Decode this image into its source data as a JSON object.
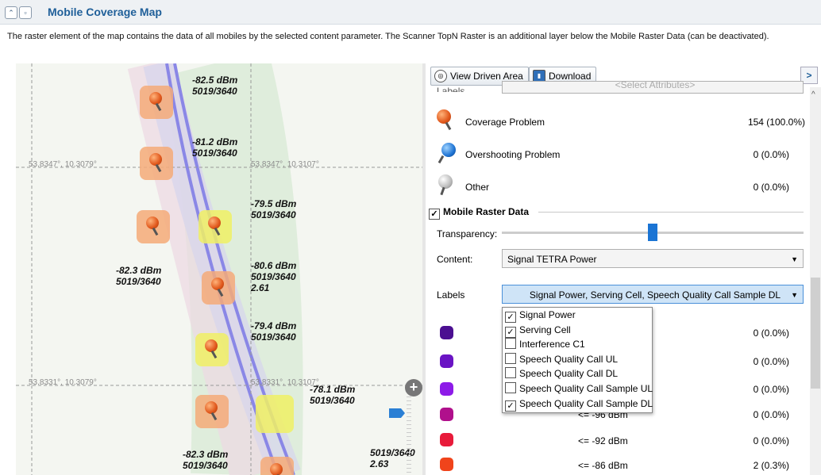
{
  "header": {
    "title": "Mobile Coverage Map",
    "collapse_icon": "double-chevron-up-icon",
    "window_icon": "window-icon"
  },
  "description": "The raster element of the map contains the data of all mobiles by the selected content parameter. The Scanner TopN Raster is an additional layer below the Mobile Raster Data (can be deactivated).",
  "map": {
    "coords": [
      "53.8347°, 10.3079°",
      "53.8347°, 10.3107°",
      "53.8331°, 10.3079°",
      "53.8331°, 10.3107°"
    ],
    "labels": [
      {
        "l1": "-82.5 dBm",
        "l2": "5019/3640",
        "l3": ""
      },
      {
        "l1": "-81.2 dBm",
        "l2": "5019/3640",
        "l3": ""
      },
      {
        "l1": "-79.5 dBm",
        "l2": "5019/3640",
        "l3": ""
      },
      {
        "l1": "-82.3 dBm",
        "l2": "5019/3640",
        "l3": ""
      },
      {
        "l1": "-80.6 dBm",
        "l2": "5019/3640",
        "l3": "2.61"
      },
      {
        "l1": "-79.4 dBm",
        "l2": "5019/3640",
        "l3": ""
      },
      {
        "l1": "-78.1 dBm",
        "l2": "5019/3640",
        "l3": ""
      },
      {
        "l1": "-82.3 dBm",
        "l2": "5019/3640",
        "l3": ""
      },
      {
        "l1": "5019/3640",
        "l2": "2.63",
        "l3": ""
      }
    ],
    "zoom_in_icon": "plus-icon"
  },
  "toolbar": {
    "view_driven_area": "View Driven Area",
    "download": "Download",
    "expand_icon": "chevron-right-icon"
  },
  "labels_row": {
    "label": "Labels",
    "placeholder": "<Select Attributes>"
  },
  "problems": [
    {
      "name": "Coverage Problem",
      "value": "154 (100.0%)",
      "icon": "orange-pin-icon"
    },
    {
      "name": "Overshooting Problem",
      "value": "0 (0.0%)",
      "icon": "blue-pin-icon"
    },
    {
      "name": "Other",
      "value": "0 (0.0%)",
      "icon": "grey-pin-icon"
    }
  ],
  "raster": {
    "section_title": "Mobile Raster Data",
    "checked": true,
    "transparency_label": "Transparency:",
    "transparency": 0.55,
    "content_label": "Content:",
    "content_value": "Signal TETRA Power",
    "labels_label": "Labels",
    "labels_value": "Signal Power, Serving Cell, Speech Quality Call Sample DL"
  },
  "dropdown": [
    {
      "label": "Signal Power",
      "checked": true
    },
    {
      "label": "Serving Cell",
      "checked": true
    },
    {
      "label": "Interference C1",
      "checked": false
    },
    {
      "label": "Speech Quality Call UL",
      "checked": false
    },
    {
      "label": "Speech Quality Call DL",
      "checked": false
    },
    {
      "label": "Speech Quality Call Sample UL",
      "checked": false
    },
    {
      "label": "Speech Quality Call Sample DL",
      "checked": true
    }
  ],
  "legend": [
    {
      "color": "#4b0f91",
      "range": "",
      "value": "0 (0.0%)"
    },
    {
      "color": "#6a14c4",
      "range": "",
      "value": "0 (0.0%)"
    },
    {
      "color": "#8d1be8",
      "range": "",
      "value": "0 (0.0%)"
    },
    {
      "color": "#b0108c",
      "range": "<= -96 dBm",
      "value": "0 (0.0%)"
    },
    {
      "color": "#e81b3a",
      "range": "<= -92 dBm",
      "value": "0 (0.0%)"
    },
    {
      "color": "#f0441b",
      "range": "<= -86 dBm",
      "value": "2 (0.3%)"
    }
  ]
}
